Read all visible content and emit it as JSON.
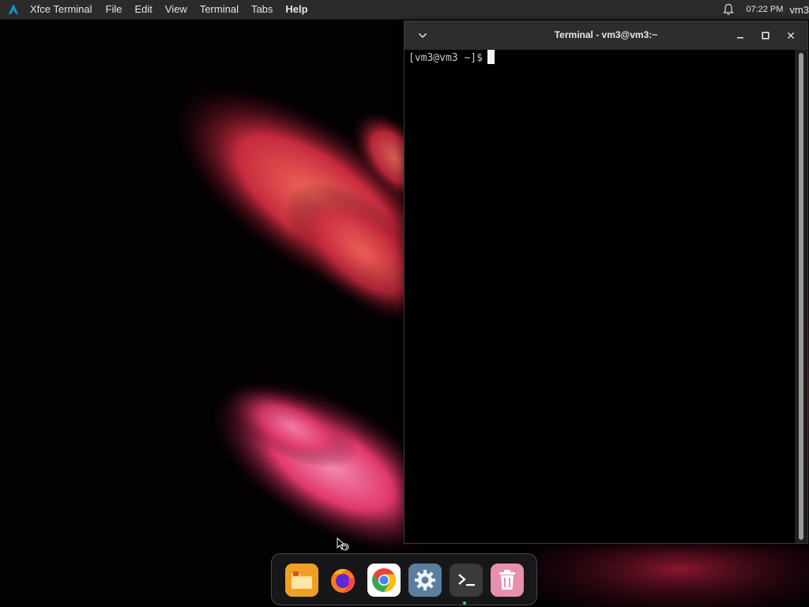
{
  "top_panel": {
    "app_name": "Xfce Terminal",
    "menu": [
      "File",
      "Edit",
      "View",
      "Terminal",
      "Tabs",
      "Help"
    ],
    "clock": "07:22 PM",
    "user": "vm3"
  },
  "terminal": {
    "title": "Terminal - vm3@vm3:~",
    "prompt": "[vm3@vm3 ~]$"
  },
  "dock": {
    "items": [
      "file-manager",
      "firefox",
      "chrome",
      "settings",
      "terminal",
      "trash"
    ]
  },
  "colors": {
    "panel_bg": "#2b2b2b",
    "titlebar_bg": "#2d2d2d",
    "accent_blue": "#1793d1",
    "running_indicator": "#3ccf6a"
  }
}
